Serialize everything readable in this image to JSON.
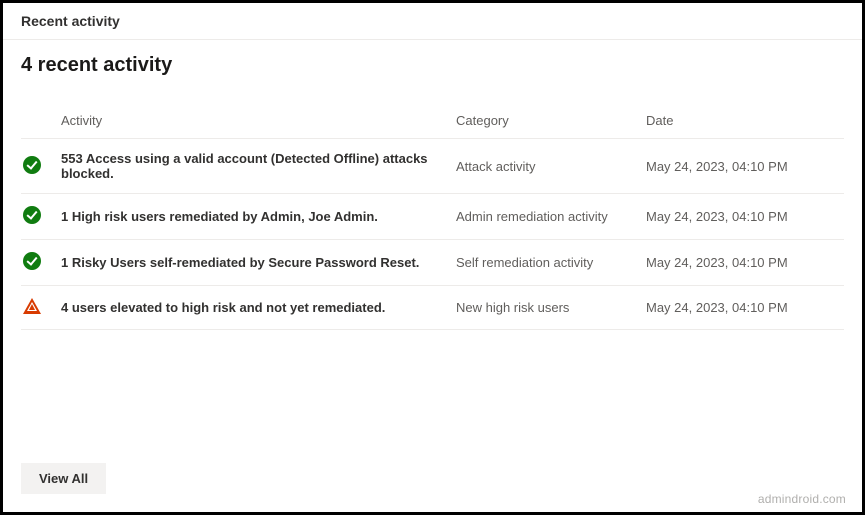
{
  "header": {
    "title": "Recent activity"
  },
  "heading": "4 recent activity",
  "columns": {
    "activity": "Activity",
    "category": "Category",
    "date": "Date"
  },
  "rows": [
    {
      "status": "success",
      "activity": "553 Access using a valid account (Detected Offline) attacks blocked.",
      "category": "Attack activity",
      "date": "May 24, 2023, 04:10 PM"
    },
    {
      "status": "success",
      "activity": "1 High risk users remediated by Admin, Joe Admin.",
      "category": "Admin remediation activity",
      "date": "May 24, 2023, 04:10 PM"
    },
    {
      "status": "success",
      "activity": "1 Risky Users self-remediated by Secure Password Reset.",
      "category": "Self remediation activity",
      "date": "May 24, 2023, 04:10 PM"
    },
    {
      "status": "warning",
      "activity": "4 users elevated to high risk and not yet remediated.",
      "category": "New high risk users",
      "date": "May 24, 2023, 04:10 PM"
    }
  ],
  "footer": {
    "view_all": "View All"
  },
  "watermark": "admindroid.com"
}
